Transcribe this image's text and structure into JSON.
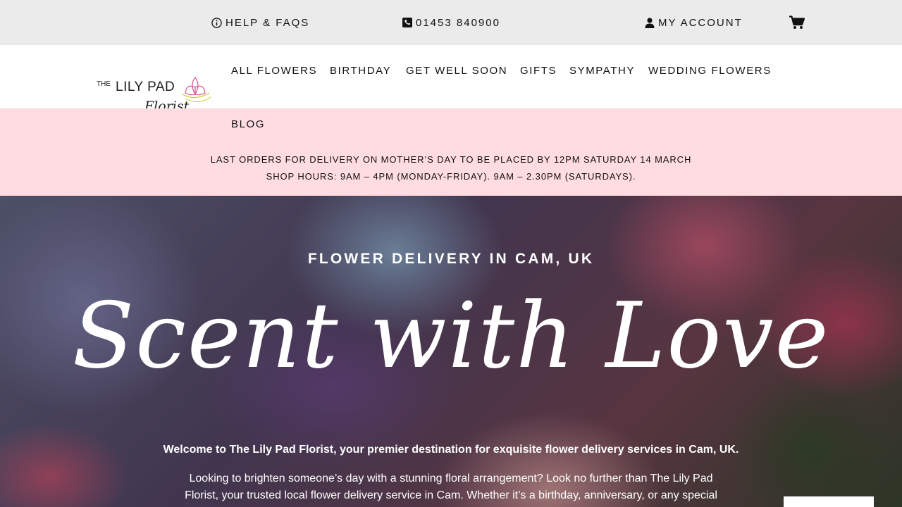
{
  "topbar": {
    "help_label": "HELP & FAQS",
    "phone_label": "01453 840900",
    "account_label": "MY ACCOUNT",
    "help_icon": "info-circle-icon",
    "phone_icon": "phone-icon",
    "account_icon": "user-icon",
    "cart_icon": "shopping-cart-icon"
  },
  "logo": {
    "small": "THE",
    "name": "LILY PAD",
    "script": "Florist"
  },
  "nav": {
    "items": [
      "ALL FLOWERS",
      "BIRTHDAY",
      "GET WELL SOON",
      "GIFTS",
      "SYMPATHY",
      "WEDDING FLOWERS",
      "BLOG"
    ]
  },
  "banner": {
    "line1": "LAST ORDERS FOR DELIVERY ON MOTHER’S DAY TO BE PLACED BY 12PM SATURDAY 14 MARCH",
    "line2": "SHOP HOURS: 9AM – 4PM (MONDAY-FRIDAY). 9AM – 2.30PM (SATURDAYS)."
  },
  "hero": {
    "eyebrow": "FLOWER DELIVERY IN CAM, UK",
    "script_title": "Scent with Love",
    "welcome": "Welcome to The Lily Pad Florist, your premier destination for exquisite flower delivery services in Cam, UK.",
    "body": "Looking to brighten someone’s day with a stunning floral arrangement? Look no further than The Lily Pad Florist, your trusted local flower delivery service in Cam. Whether it’s a birthday, anniversary, or any special"
  },
  "colors": {
    "topbar_bg": "#ebebeb",
    "banner_bg": "#ffdbe2",
    "text": "#111111",
    "logo_accent": "#d6468c"
  }
}
